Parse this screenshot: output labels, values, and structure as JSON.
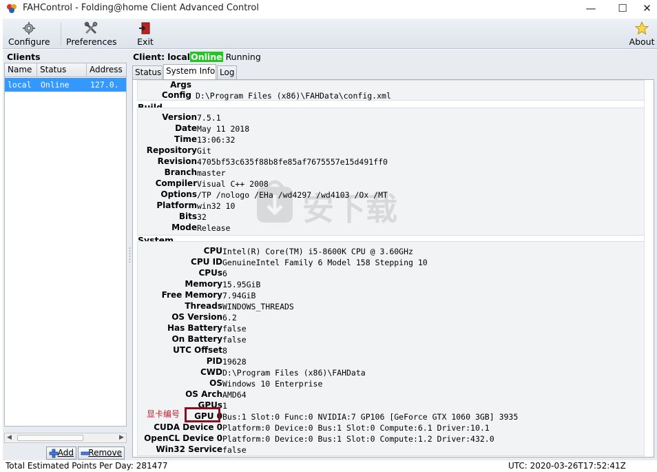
{
  "window": {
    "title": "FAHControl - Folding@home Client Advanced Control",
    "min_glyph": "—",
    "max_glyph": "☐",
    "close_glyph": "✕"
  },
  "toolbar": {
    "configure_label": "Configure",
    "preferences_label": "Preferences",
    "exit_label": "Exit",
    "about_label": "About"
  },
  "clients": {
    "title": "Clients",
    "columns": [
      "Name",
      "Status",
      "Address"
    ],
    "rows": [
      {
        "name": "local",
        "status": "Online",
        "address": "127.0."
      }
    ],
    "add_label": "Add",
    "remove_label": "Remove"
  },
  "client_header": {
    "prefix": "Client:",
    "name": "local",
    "state": "Online",
    "activity": "Running"
  },
  "tabs": {
    "status": "Status",
    "system_info": "System Info",
    "log": "Log"
  },
  "sysinfo": {
    "args_label": "Args",
    "args_value": "",
    "config_label": "Config",
    "config_value": "D:\\Program Files (x86)\\FAHData\\config.xml",
    "build_title": "Build",
    "build": [
      {
        "label": "Version",
        "value": "7.5.1"
      },
      {
        "label": "Date",
        "value": "May 11 2018"
      },
      {
        "label": "Time",
        "value": "13:06:32"
      },
      {
        "label": "Repository",
        "value": "Git"
      },
      {
        "label": "Revision",
        "value": "4705bf53c635f88b8fe85af7675557e15d491ff0"
      },
      {
        "label": "Branch",
        "value": "master"
      },
      {
        "label": "Compiler",
        "value": "Visual C++ 2008"
      },
      {
        "label": "Options",
        "value": "/TP  /nologo /EHa /wd4297 /wd4103 /Ox /MT"
      },
      {
        "label": "Platform",
        "value": "win32 10"
      },
      {
        "label": "Bits",
        "value": "32"
      },
      {
        "label": "Mode",
        "value": "Release"
      }
    ],
    "system_title": "System",
    "system": [
      {
        "label": "CPU",
        "value": "Intel(R) Core(TM) i5-8600K CPU @ 3.60GHz"
      },
      {
        "label": "CPU ID",
        "value": "GenuineIntel Family 6 Model 158 Stepping 10"
      },
      {
        "label": "CPUs",
        "value": "6"
      },
      {
        "label": "Memory",
        "value": "15.95GiB"
      },
      {
        "label": "Free Memory",
        "value": "7.94GiB"
      },
      {
        "label": "Threads",
        "value": "WINDOWS_THREADS"
      },
      {
        "label": "OS Version",
        "value": "6.2"
      },
      {
        "label": "Has Battery",
        "value": "false"
      },
      {
        "label": "On Battery",
        "value": "false"
      },
      {
        "label": "UTC Offset",
        "value": "8"
      },
      {
        "label": "PID",
        "value": "19628"
      },
      {
        "label": "CWD",
        "value": "D:\\Program Files (x86)\\FAHData"
      },
      {
        "label": "OS",
        "value": "Windows 10 Enterprise"
      },
      {
        "label": "OS Arch",
        "value": "AMD64"
      },
      {
        "label": "GPUs",
        "value": "1"
      },
      {
        "label": "GPU 0",
        "value": "Bus:1 Slot:0 Func:0 NVIDIA:7 GP106 [GeForce GTX 1060 3GB] 3935"
      },
      {
        "label": "CUDA Device 0",
        "value": "Platform:0 Device:0 Bus:1 Slot:0 Compute:6.1 Driver:10.1"
      },
      {
        "label": "OpenCL Device 0",
        "value": "Platform:0 Device:0 Bus:1 Slot:0 Compute:1.2 Driver:432.0"
      },
      {
        "label": "Win32 Service",
        "value": "false"
      }
    ]
  },
  "annotation": {
    "gpu_note": "显卡编号"
  },
  "watermark": {
    "text": "安下载"
  },
  "statusbar": {
    "ppd": "Total Estimated Points Per Day: 281477",
    "utc": "UTC: 2020-03-26T17:52:41Z"
  },
  "colors": {
    "online_badge": "#22c622",
    "selection": "#3399ff",
    "highlight_box": "#8b0f1f",
    "annotation_text": "#c41c2a"
  }
}
